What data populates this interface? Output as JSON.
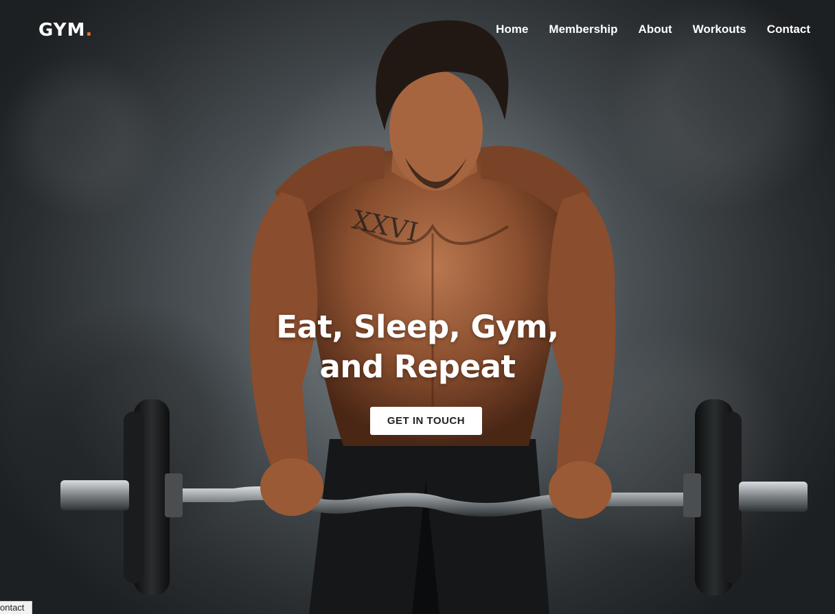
{
  "brand": {
    "name": "GYM",
    "dot": ".",
    "accent_color": "#e8722a"
  },
  "nav": {
    "items": [
      "Home",
      "Membership",
      "About",
      "Workouts",
      "Contact"
    ]
  },
  "hero": {
    "headline_line1": "Eat, Sleep, Gym,",
    "headline_line2": "and Repeat",
    "cta_label": "GET IN TOUCH",
    "background_image": "athlete-curling-barbell-photo"
  },
  "status_bar": {
    "link_hint": "ontact"
  }
}
